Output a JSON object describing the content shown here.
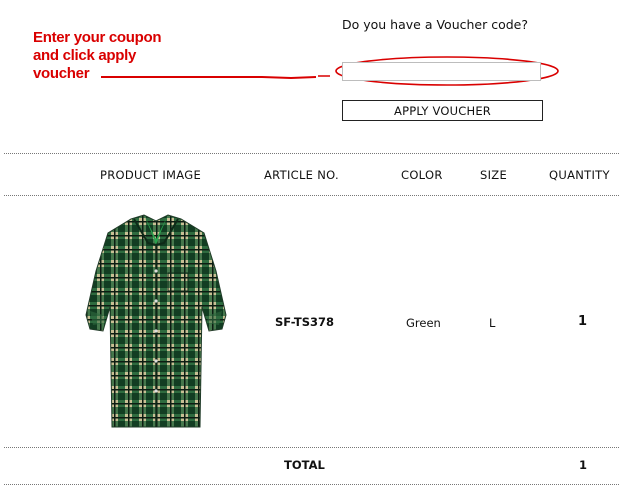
{
  "annotation": {
    "lines": [
      "Enter your coupon",
      "and click apply",
      "voucher"
    ],
    "color": "#d90000"
  },
  "voucher": {
    "question": "Do you have a Voucher code?",
    "input_value": "",
    "apply_label": "APPLY VOUCHER"
  },
  "table": {
    "headers": [
      "PRODUCT IMAGE",
      "ARTICLE NO.",
      "COLOR",
      "SIZE",
      "QUANTITY"
    ],
    "rows": [
      {
        "image_icon": "green-checked-shirt",
        "article_no": "SF-TS378",
        "color": "Green",
        "size": "L",
        "quantity": "1"
      }
    ],
    "total_label": "TOTAL",
    "total_quantity": "1"
  }
}
